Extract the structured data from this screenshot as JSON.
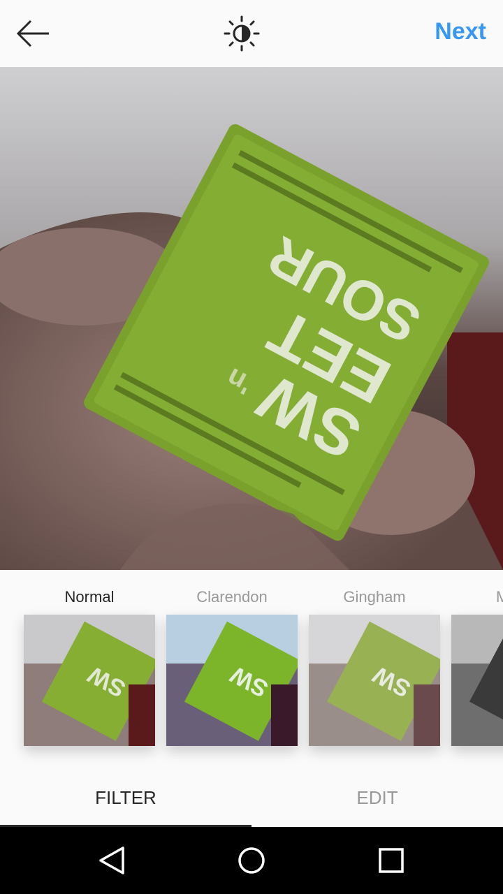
{
  "header": {
    "next_label": "Next",
    "back_icon": "arrow-left-icon",
    "adjust_icon": "lux-brightness-icon",
    "accent_color": "#3897f0"
  },
  "photo": {
    "description_icon": "photo-preview"
  },
  "filters": [
    {
      "name": "Normal",
      "active": true
    },
    {
      "name": "Clarendon",
      "active": false
    },
    {
      "name": "Gingham",
      "active": false
    },
    {
      "name": "M",
      "active": false
    }
  ],
  "tabs": {
    "filter_label": "FILTER",
    "edit_label": "EDIT",
    "selected": "FILTER"
  },
  "system_nav": {
    "back_icon": "triangle-back-icon",
    "home_icon": "circle-home-icon",
    "recents_icon": "square-recents-icon"
  }
}
